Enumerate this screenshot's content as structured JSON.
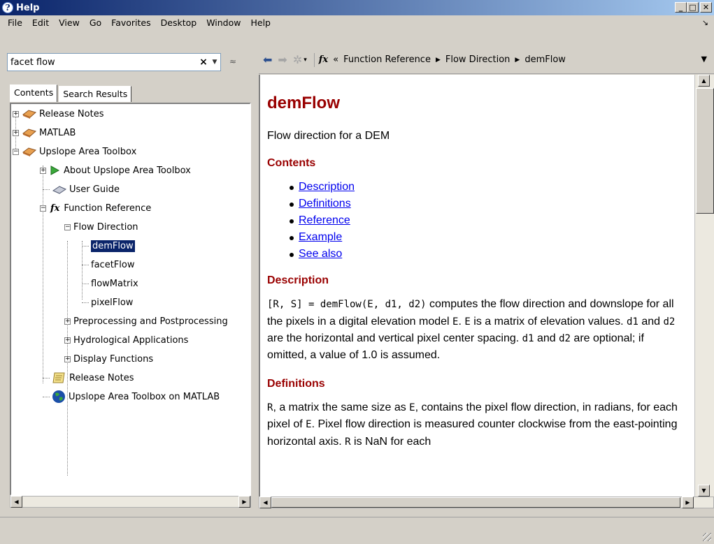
{
  "window": {
    "title": "Help"
  },
  "menu": [
    "File",
    "Edit",
    "View",
    "Go",
    "Favorites",
    "Desktop",
    "Window",
    "Help"
  ],
  "search": {
    "value": "facet flow"
  },
  "tabs": [
    "Contents",
    "Search Results"
  ],
  "tree": [
    {
      "label": "Release Notes",
      "icon": "book-icon"
    },
    {
      "label": "MATLAB",
      "icon": "book-icon"
    },
    {
      "label": "Upslope Area Toolbox",
      "icon": "book-icon"
    },
    {
      "label": "About Upslope Area Toolbox",
      "icon": "play-icon"
    },
    {
      "label": "User Guide",
      "icon": "guide-icon"
    },
    {
      "label": "Function Reference",
      "icon": "fx-icon"
    },
    {
      "label": "Flow Direction"
    },
    {
      "label": "demFlow",
      "selected": true
    },
    {
      "label": "facetFlow"
    },
    {
      "label": "flowMatrix"
    },
    {
      "label": "pixelFlow"
    },
    {
      "label": "Preprocessing and Postprocessing"
    },
    {
      "label": "Hydrological Applications"
    },
    {
      "label": "Display Functions"
    },
    {
      "label": "Release Notes",
      "icon": "notes-icon"
    },
    {
      "label": "Upslope Area Toolbox on MATLAB",
      "icon": "globe-icon"
    }
  ],
  "nav": {
    "breadcrumb": [
      "Function Reference",
      "Flow Direction",
      "demFlow"
    ],
    "prefix": "«"
  },
  "page": {
    "title": "demFlow",
    "summary": "Flow direction for a DEM",
    "contents_heading": "Contents",
    "toc": [
      "Description",
      "Definitions",
      "Reference",
      "Example",
      "See also"
    ],
    "description_heading": "Description",
    "desc_code": "[R, S] = demFlow(E, d1, d2)",
    "desc_text1": " computes the flow direction and downslope for all the pixels in a digital elevation model ",
    "desc_E": "E",
    "desc_text2": ". ",
    "desc_E2": "E",
    "desc_text3": " is a matrix of elevation values. ",
    "desc_d1": "d1",
    "desc_text4": " and ",
    "desc_d2": "d2",
    "desc_text5": " are the horizontal and vertical pixel center spacing. ",
    "desc_d1b": "d1",
    "desc_text6": " and ",
    "desc_d2b": "d2",
    "desc_text7": " are optional; if omitted, a value of 1.0 is assumed.",
    "definitions_heading": "Definitions",
    "def_R": "R",
    "def_text1": ", a matrix the same size as ",
    "def_E": "E",
    "def_text2": ", contains the pixel flow direction, in radians, for each pixel of ",
    "def_E2": "E",
    "def_text3": ". Pixel flow direction is measured counter clockwise from the east-pointing horizontal axis. ",
    "def_R2": "R",
    "def_text4": " is NaN for each"
  }
}
